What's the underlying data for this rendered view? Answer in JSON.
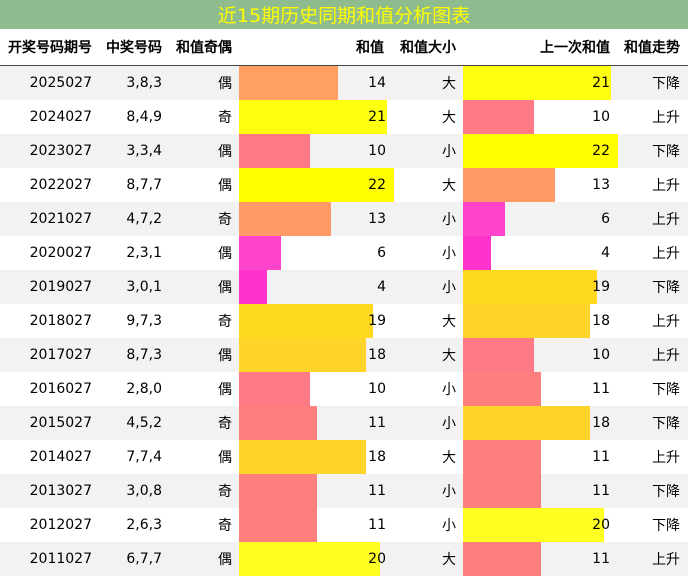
{
  "title": "近15期历史同期和值分析图表",
  "headers": {
    "issue": "开奖号码期号",
    "numbers": "中奖号码",
    "odd_even": "和值奇偶",
    "sum": "和值",
    "size": "和值大小",
    "prev_sum": "上一次和值",
    "trend": "和值走势"
  },
  "bar_colors": {
    "4": "#ff33cc",
    "6": "#ff44cc",
    "10": "#ff7a85",
    "11": "#ff7f7f",
    "13": "#ff9966",
    "14": "#ffa060",
    "18": "#ffd42a",
    "19": "#ffd820",
    "20": "#ffff22",
    "21": "#ffff10",
    "22": "#ffff00"
  },
  "rows": [
    {
      "issue": "2025027",
      "numbers": "3,8,3",
      "odd_even": "偶",
      "sum": 14,
      "size": "大",
      "prev_sum": 21,
      "trend": "下降"
    },
    {
      "issue": "2024027",
      "numbers": "8,4,9",
      "odd_even": "奇",
      "sum": 21,
      "size": "大",
      "prev_sum": 10,
      "trend": "上升"
    },
    {
      "issue": "2023027",
      "numbers": "3,3,4",
      "odd_even": "偶",
      "sum": 10,
      "size": "小",
      "prev_sum": 22,
      "trend": "下降"
    },
    {
      "issue": "2022027",
      "numbers": "8,7,7",
      "odd_even": "偶",
      "sum": 22,
      "size": "大",
      "prev_sum": 13,
      "trend": "上升"
    },
    {
      "issue": "2021027",
      "numbers": "4,7,2",
      "odd_even": "奇",
      "sum": 13,
      "size": "小",
      "prev_sum": 6,
      "trend": "上升"
    },
    {
      "issue": "2020027",
      "numbers": "2,3,1",
      "odd_even": "偶",
      "sum": 6,
      "size": "小",
      "prev_sum": 4,
      "trend": "上升"
    },
    {
      "issue": "2019027",
      "numbers": "3,0,1",
      "odd_even": "偶",
      "sum": 4,
      "size": "小",
      "prev_sum": 19,
      "trend": "下降"
    },
    {
      "issue": "2018027",
      "numbers": "9,7,3",
      "odd_even": "奇",
      "sum": 19,
      "size": "大",
      "prev_sum": 18,
      "trend": "上升"
    },
    {
      "issue": "2017027",
      "numbers": "8,7,3",
      "odd_even": "偶",
      "sum": 18,
      "size": "大",
      "prev_sum": 10,
      "trend": "上升"
    },
    {
      "issue": "2016027",
      "numbers": "2,8,0",
      "odd_even": "偶",
      "sum": 10,
      "size": "小",
      "prev_sum": 11,
      "trend": "下降"
    },
    {
      "issue": "2015027",
      "numbers": "4,5,2",
      "odd_even": "奇",
      "sum": 11,
      "size": "小",
      "prev_sum": 18,
      "trend": "下降"
    },
    {
      "issue": "2014027",
      "numbers": "7,7,4",
      "odd_even": "偶",
      "sum": 18,
      "size": "大",
      "prev_sum": 11,
      "trend": "上升"
    },
    {
      "issue": "2013027",
      "numbers": "3,0,8",
      "odd_even": "奇",
      "sum": 11,
      "size": "小",
      "prev_sum": 11,
      "trend": "下降"
    },
    {
      "issue": "2012027",
      "numbers": "2,6,3",
      "odd_even": "奇",
      "sum": 11,
      "size": "小",
      "prev_sum": 20,
      "trend": "下降"
    },
    {
      "issue": "2011027",
      "numbers": "6,7,7",
      "odd_even": "偶",
      "sum": 20,
      "size": "大",
      "prev_sum": 11,
      "trend": "上升"
    }
  ]
}
